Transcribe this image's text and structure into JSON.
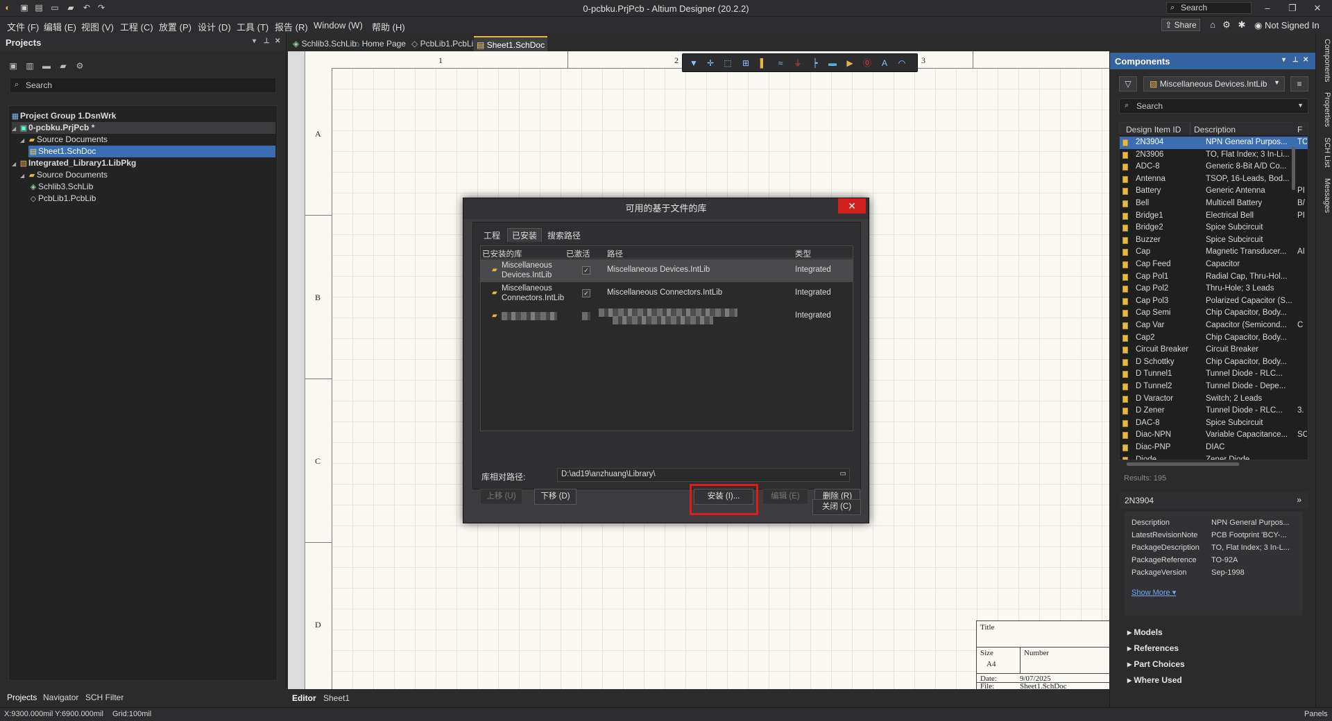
{
  "window": {
    "title": "0-pcbku.PrjPcb - Altium Designer (20.2.2)",
    "search_placeholder": "Search"
  },
  "menubar": {
    "items": [
      "文件 (F)",
      "编辑 (E)",
      "视图 (V)",
      "工程 (C)",
      "放置 (P)",
      "设计 (D)",
      "工具 (T)",
      "报告 (R)",
      "Window (W)",
      "帮助 (H)"
    ],
    "share": "Share",
    "user": "Not Signed In"
  },
  "projects_panel": {
    "title": "Projects",
    "search_placeholder": "Search",
    "tree": [
      {
        "label": "Project Group 1.DsnWrk",
        "level": 0
      },
      {
        "label": "0-pcbku.PrjPcb *",
        "level": 1
      },
      {
        "label": "Source Documents",
        "level": 2
      },
      {
        "label": "Sheet1.SchDoc",
        "level": 3,
        "selected": true
      },
      {
        "label": "Integrated_Library1.LibPkg",
        "level": 1
      },
      {
        "label": "Source Documents",
        "level": 2
      },
      {
        "label": "Schlib3.SchLib",
        "level": 3
      },
      {
        "label": "PcbLib1.PcbLib",
        "level": 3
      }
    ],
    "bottom_tabs": [
      "Projects",
      "Navigator",
      "SCH Filter"
    ]
  },
  "doc_tabs": [
    "Schlib3.SchLib",
    "Home Page",
    "PcbLib1.PcbLib",
    "Sheet1.SchDoc"
  ],
  "sheet": {
    "col_labels": [
      "1",
      "2",
      "3"
    ],
    "row_labels": [
      "A",
      "B",
      "C",
      "D"
    ],
    "title_block": {
      "title": "Title",
      "size_label": "Size",
      "size": "A4",
      "number_label": "Number",
      "date_label": "Date:",
      "date": "9/07/2025",
      "file_label": "File:",
      "file": "Sheet1.SchDoc"
    }
  },
  "editor_tabs": [
    "Editor",
    "Sheet1"
  ],
  "status": {
    "coords": "X:9300.000mil Y:6900.000mil",
    "grid": "Grid:100mil",
    "panels": "Panels"
  },
  "right_strip": [
    "Components",
    "Properties",
    "SCH List",
    "Messages"
  ],
  "components": {
    "title": "Components",
    "library": "Miscellaneous Devices.IntLib",
    "search_placeholder": "Search",
    "columns": [
      "Design Item ID",
      "Description",
      "F"
    ],
    "rows": [
      {
        "id": "2N3904",
        "desc": "NPN General Purpos...",
        "f": "TC",
        "selected": true
      },
      {
        "id": "2N3906",
        "desc": "TO, Flat Index; 3 In-Li...",
        "f": ""
      },
      {
        "id": "ADC-8",
        "desc": "Generic 8-Bit A/D Co...",
        "f": ""
      },
      {
        "id": "Antenna",
        "desc": "TSOP, 16-Leads, Bod...",
        "f": ""
      },
      {
        "id": "Battery",
        "desc": "Generic Antenna",
        "f": "PI"
      },
      {
        "id": "Bell",
        "desc": "Multicell Battery",
        "f": "B/"
      },
      {
        "id": "Bridge1",
        "desc": "Electrical Bell",
        "f": "PI"
      },
      {
        "id": "Bridge2",
        "desc": "Spice Subcircuit",
        "f": ""
      },
      {
        "id": "Buzzer",
        "desc": "Spice Subcircuit",
        "f": ""
      },
      {
        "id": "Cap",
        "desc": "Magnetic Transducer...",
        "f": "AI"
      },
      {
        "id": "Cap Feed",
        "desc": "Capacitor",
        "f": ""
      },
      {
        "id": "Cap Pol1",
        "desc": "Radial Cap, Thru-Hol...",
        "f": ""
      },
      {
        "id": "Cap Pol2",
        "desc": "Thru-Hole; 3 Leads",
        "f": ""
      },
      {
        "id": "Cap Pol3",
        "desc": "Polarized Capacitor (S...",
        "f": ""
      },
      {
        "id": "Cap Semi",
        "desc": "Chip Capacitor, Body...",
        "f": ""
      },
      {
        "id": "Cap Var",
        "desc": "Capacitor (Semicond...",
        "f": "C"
      },
      {
        "id": "Cap2",
        "desc": "Chip Capacitor, Body...",
        "f": ""
      },
      {
        "id": "Circuit Breaker",
        "desc": "Circuit Breaker",
        "f": ""
      },
      {
        "id": "D Schottky",
        "desc": "Chip Capacitor, Body...",
        "f": ""
      },
      {
        "id": "D Tunnel1",
        "desc": "Tunnel Diode - RLC...",
        "f": ""
      },
      {
        "id": "D Tunnel2",
        "desc": "Tunnel Diode - Depe...",
        "f": ""
      },
      {
        "id": "D Varactor",
        "desc": "Switch; 2 Leads",
        "f": ""
      },
      {
        "id": "D Zener",
        "desc": "Tunnel Diode - RLC...",
        "f": "3."
      },
      {
        "id": "DAC-8",
        "desc": "Spice Subcircuit",
        "f": ""
      },
      {
        "id": "Diac-NPN",
        "desc": "Variable Capacitance...",
        "f": "SC"
      },
      {
        "id": "Diac-PNP",
        "desc": "DIAC",
        "f": ""
      },
      {
        "id": "Diode",
        "desc": "Zener Diode",
        "f": ""
      }
    ],
    "results": "Results: 195",
    "detail": {
      "name": "2N3904",
      "props": [
        {
          "k": "Description",
          "v": "NPN General Purpos..."
        },
        {
          "k": "LatestRevisionNote",
          "v": "PCB Footprint 'BCY-..."
        },
        {
          "k": "PackageDescription",
          "v": "TO, Flat Index; 3 In-L..."
        },
        {
          "k": "PackageReference",
          "v": "TO-92A"
        },
        {
          "k": "PackageVersion",
          "v": "Sep-1998"
        }
      ],
      "show_more": "Show More ▾",
      "sections": [
        "Models",
        "References",
        "Part Choices",
        "Where Used"
      ]
    }
  },
  "dialog": {
    "title": "可用的基于文件的库",
    "tabs": [
      "工程",
      "已安装",
      "搜索路径"
    ],
    "columns": [
      "已安装的库",
      "已激活",
      "路径",
      "类型"
    ],
    "rows": [
      {
        "name": "Miscellaneous Devices.IntLib",
        "path": "Miscellaneous Devices.IntLib",
        "type": "Integrated"
      },
      {
        "name": "Miscellaneous Connectors.IntLib",
        "path": "Miscellaneous Connectors.IntLib",
        "type": "Integrated"
      },
      {
        "name": "",
        "path": "",
        "type": "Integrated"
      }
    ],
    "path_label": "库相对路径:",
    "path_value": "D:\\ad19\\anzhuang\\Library\\",
    "buttons": {
      "up": "上移 (U)",
      "down": "下移 (D)",
      "install": "安装 (I)...",
      "edit": "编辑 (E)",
      "remove": "删除 (R)",
      "close": "关闭 (C)"
    }
  },
  "colors": {
    "accent": "#3a6db1",
    "highlight": "#e01b1b",
    "close": "#d0201d"
  }
}
